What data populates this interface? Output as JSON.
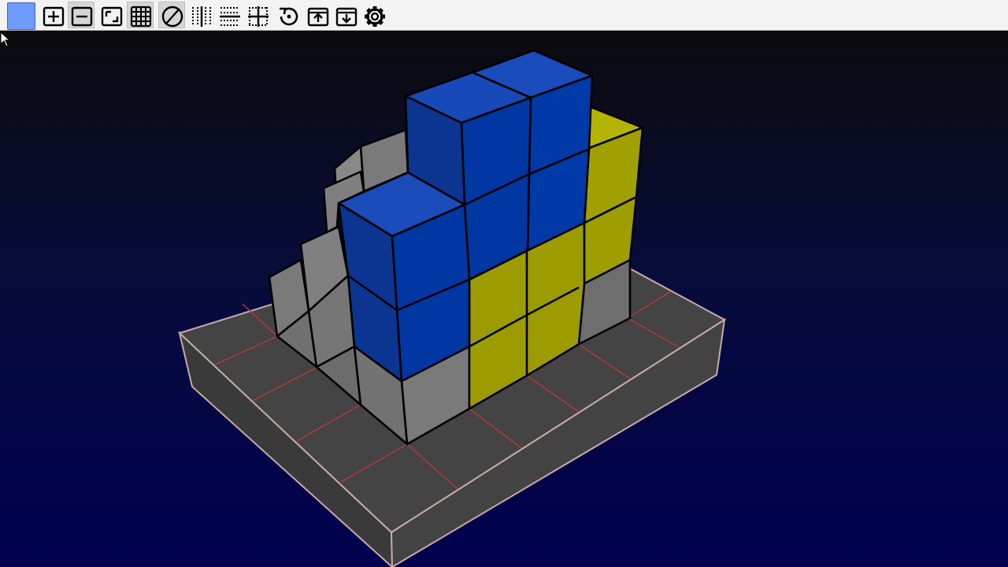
{
  "app": {
    "toolbar": {
      "buttons": [
        {
          "name": "color-swatch-button",
          "icon": "color-swatch",
          "color": "#6f9bff",
          "pressed": false
        },
        {
          "name": "add-block-button",
          "icon": "plus-square-icon",
          "pressed": false
        },
        {
          "name": "remove-block-button",
          "icon": "minus-square-icon",
          "pressed": true
        },
        {
          "name": "paint-mode-button",
          "icon": "corner-square-icon",
          "pressed": false
        },
        {
          "name": "grid-toggle-button",
          "icon": "grid-icon",
          "pressed": true
        },
        {
          "name": "clear-button",
          "icon": "prohibit-icon",
          "pressed": true
        },
        {
          "name": "mirror-x-button",
          "icon": "mirror-x-icon",
          "pressed": false
        },
        {
          "name": "mirror-y-button",
          "icon": "mirror-y-icon",
          "pressed": false
        },
        {
          "name": "mirror-xy-button",
          "icon": "mirror-xy-icon",
          "pressed": false
        },
        {
          "name": "reset-view-button",
          "icon": "rotate-reset-icon",
          "pressed": false
        },
        {
          "name": "export-button",
          "icon": "upload-box-icon",
          "pressed": false
        },
        {
          "name": "import-button",
          "icon": "download-box-icon",
          "pressed": false
        },
        {
          "name": "settings-button",
          "icon": "gear-icon",
          "pressed": false
        }
      ]
    },
    "scene": {
      "palette": {
        "blue": "#0033a0",
        "yellow": "#9b9b00",
        "gray": "#6f6f6f",
        "base": "#3f3f3f",
        "grid_line": "#b03030",
        "base_edge": "#c8a4a4"
      },
      "cursor": "arrow-cursor"
    }
  }
}
